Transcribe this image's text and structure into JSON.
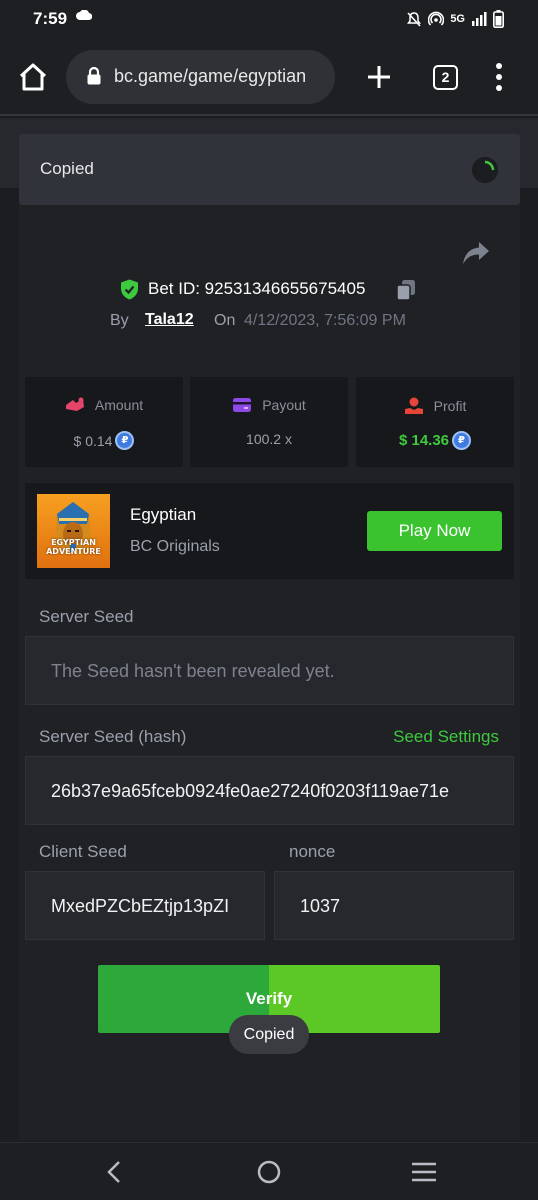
{
  "status_bar": {
    "time": "7:59",
    "network": "5G"
  },
  "browser": {
    "url": "bc.game/game/egyptian",
    "tab_count": "2"
  },
  "banner": {
    "text": "Copied"
  },
  "bet": {
    "id_text": "Bet ID: 92531346655675405",
    "by_label": "By",
    "username": "Tala12",
    "on_label": "On",
    "datetime": "4/12/2023, 7:56:09 PM"
  },
  "stats": {
    "amount_label": "Amount",
    "amount_value": "$ 0.14",
    "payout_label": "Payout",
    "payout_value": "100.2 x",
    "profit_label": "Profit",
    "profit_value": "$ 14.36",
    "coin_symbol": "₽"
  },
  "game": {
    "title": "Egyptian",
    "provider": "BC Originals",
    "thumb_text_1": "EGYPTIAN",
    "thumb_text_2": "ADVENTURE",
    "play_label": "Play Now"
  },
  "server_seed": {
    "label": "Server Seed",
    "value": "The Seed hasn't been revealed yet."
  },
  "server_seed_hash": {
    "label": "Server Seed (hash)",
    "settings_link": "Seed Settings",
    "value": "26b37e9a65fceb0924fe0ae27240f0203f119ae71e"
  },
  "client_seed": {
    "label": "Client Seed",
    "value": "MxedPZCbEZtjp13pZI"
  },
  "nonce": {
    "label": "nonce",
    "value": "1037"
  },
  "verify": {
    "label": "Verify"
  },
  "toast": {
    "text": "Copied"
  },
  "colors": {
    "accent_green": "#3ec93e",
    "play_button": "#3bc22f",
    "coin_blue": "#3f7be0",
    "amount_icon": "#e5456b",
    "payout_icon": "#8e4ae8",
    "profit_icon": "#e8453a"
  }
}
